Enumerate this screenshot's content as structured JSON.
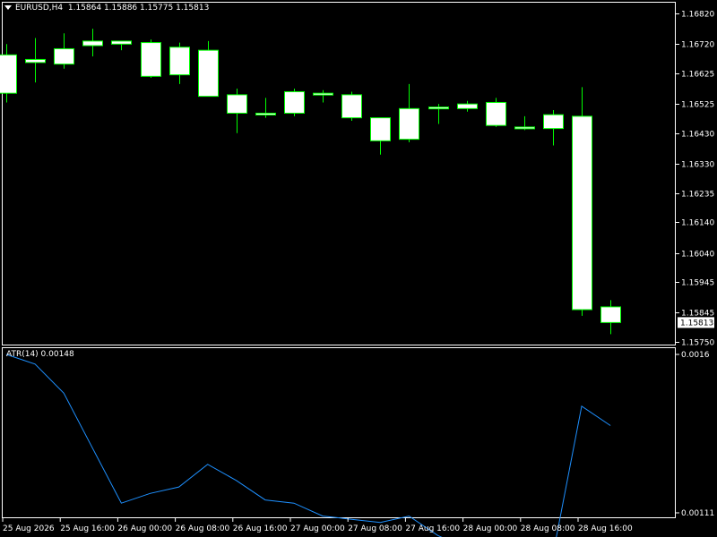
{
  "header": {
    "symbol": "EURUSD,H4",
    "ohlc": "1.15864 1.15886 1.15775 1.15813"
  },
  "indicator": {
    "label": "ATR(14) 0.00148",
    "axis_top_label": "0.0016",
    "axis_bottom_label": "0.00111"
  },
  "colors": {
    "background": "#000000",
    "axis": "#ffffff",
    "candle_outline": "#00ff00",
    "candle_body": "#ffffff",
    "atr_line": "#1e90ff",
    "price_label_bg": "#ffffff",
    "price_label_text": "#000000"
  },
  "chart_data": [
    {
      "type": "candlestick",
      "ylim": [
        1.15735,
        1.16855
      ],
      "y_ticks": [
        "1.16820",
        "1.16720",
        "1.16625",
        "1.16525",
        "1.16430",
        "1.16330",
        "1.16235",
        "1.16140",
        "1.16040",
        "1.15945",
        "1.15845",
        "1.15750"
      ],
      "y_tick_values": [
        1.1682,
        1.1672,
        1.16625,
        1.16525,
        1.1643,
        1.1633,
        1.16235,
        1.1614,
        1.1604,
        1.15945,
        1.15845,
        1.1575
      ],
      "current_price_label": "1.15813",
      "current_price": 1.15813,
      "candles": [
        {
          "o": 1.16685,
          "h": 1.1672,
          "l": 1.1653,
          "c": 1.1656
        },
        {
          "o": 1.1666,
          "h": 1.1674,
          "l": 1.16595,
          "c": 1.1667
        },
        {
          "o": 1.16655,
          "h": 1.16755,
          "l": 1.1664,
          "c": 1.16705
        },
        {
          "o": 1.16715,
          "h": 1.1677,
          "l": 1.1668,
          "c": 1.1673
        },
        {
          "o": 1.1672,
          "h": 1.1673,
          "l": 1.167,
          "c": 1.1673
        },
        {
          "o": 1.16725,
          "h": 1.16735,
          "l": 1.1661,
          "c": 1.16615
        },
        {
          "o": 1.1671,
          "h": 1.16725,
          "l": 1.1659,
          "c": 1.1662
        },
        {
          "o": 1.167,
          "h": 1.1673,
          "l": 1.1656,
          "c": 1.1655
        },
        {
          "o": 1.16555,
          "h": 1.16575,
          "l": 1.1643,
          "c": 1.16495
        },
        {
          "o": 1.1649,
          "h": 1.16545,
          "l": 1.1648,
          "c": 1.16495
        },
        {
          "o": 1.16565,
          "h": 1.16575,
          "l": 1.16485,
          "c": 1.16495
        },
        {
          "o": 1.16555,
          "h": 1.1657,
          "l": 1.1653,
          "c": 1.1656
        },
        {
          "o": 1.16555,
          "h": 1.16565,
          "l": 1.1647,
          "c": 1.1648
        },
        {
          "o": 1.1648,
          "h": 1.1648,
          "l": 1.1636,
          "c": 1.16405
        },
        {
          "o": 1.1651,
          "h": 1.1659,
          "l": 1.164,
          "c": 1.1641
        },
        {
          "o": 1.16515,
          "h": 1.16525,
          "l": 1.1646,
          "c": 1.1651
        },
        {
          "o": 1.1651,
          "h": 1.16535,
          "l": 1.165,
          "c": 1.16525
        },
        {
          "o": 1.1653,
          "h": 1.16545,
          "l": 1.1645,
          "c": 1.16455
        },
        {
          "o": 1.1645,
          "h": 1.16485,
          "l": 1.1644,
          "c": 1.16445
        },
        {
          "o": 1.1649,
          "h": 1.16505,
          "l": 1.1639,
          "c": 1.16445
        },
        {
          "o": 1.16485,
          "h": 1.1658,
          "l": 1.15835,
          "c": 1.15855
        },
        {
          "o": 1.15864,
          "h": 1.15886,
          "l": 1.15775,
          "c": 1.15813
        }
      ]
    },
    {
      "type": "line",
      "name": "ATR(14)",
      "ylim": [
        0.00111,
        0.0016
      ],
      "values": [
        0.0016,
        0.00157,
        0.00148,
        0.00131,
        0.00114,
        0.00117,
        0.00119,
        0.00126,
        0.00121,
        0.00115,
        0.00114,
        0.0011,
        0.00109,
        0.00108,
        0.0011,
        0.00104,
        0.001,
        0.001,
        0.00101,
        0.00098,
        0.00144,
        0.00138
      ]
    }
  ],
  "x_labels": [
    "25 Aug 2026",
    "25 Aug 16:00",
    "26 Aug 00:00",
    "26 Aug 08:00",
    "26 Aug 16:00",
    "27 Aug 00:00",
    "27 Aug 08:00",
    "27 Aug 16:00",
    "28 Aug 00:00",
    "28 Aug 08:00",
    "28 Aug 16:00"
  ]
}
